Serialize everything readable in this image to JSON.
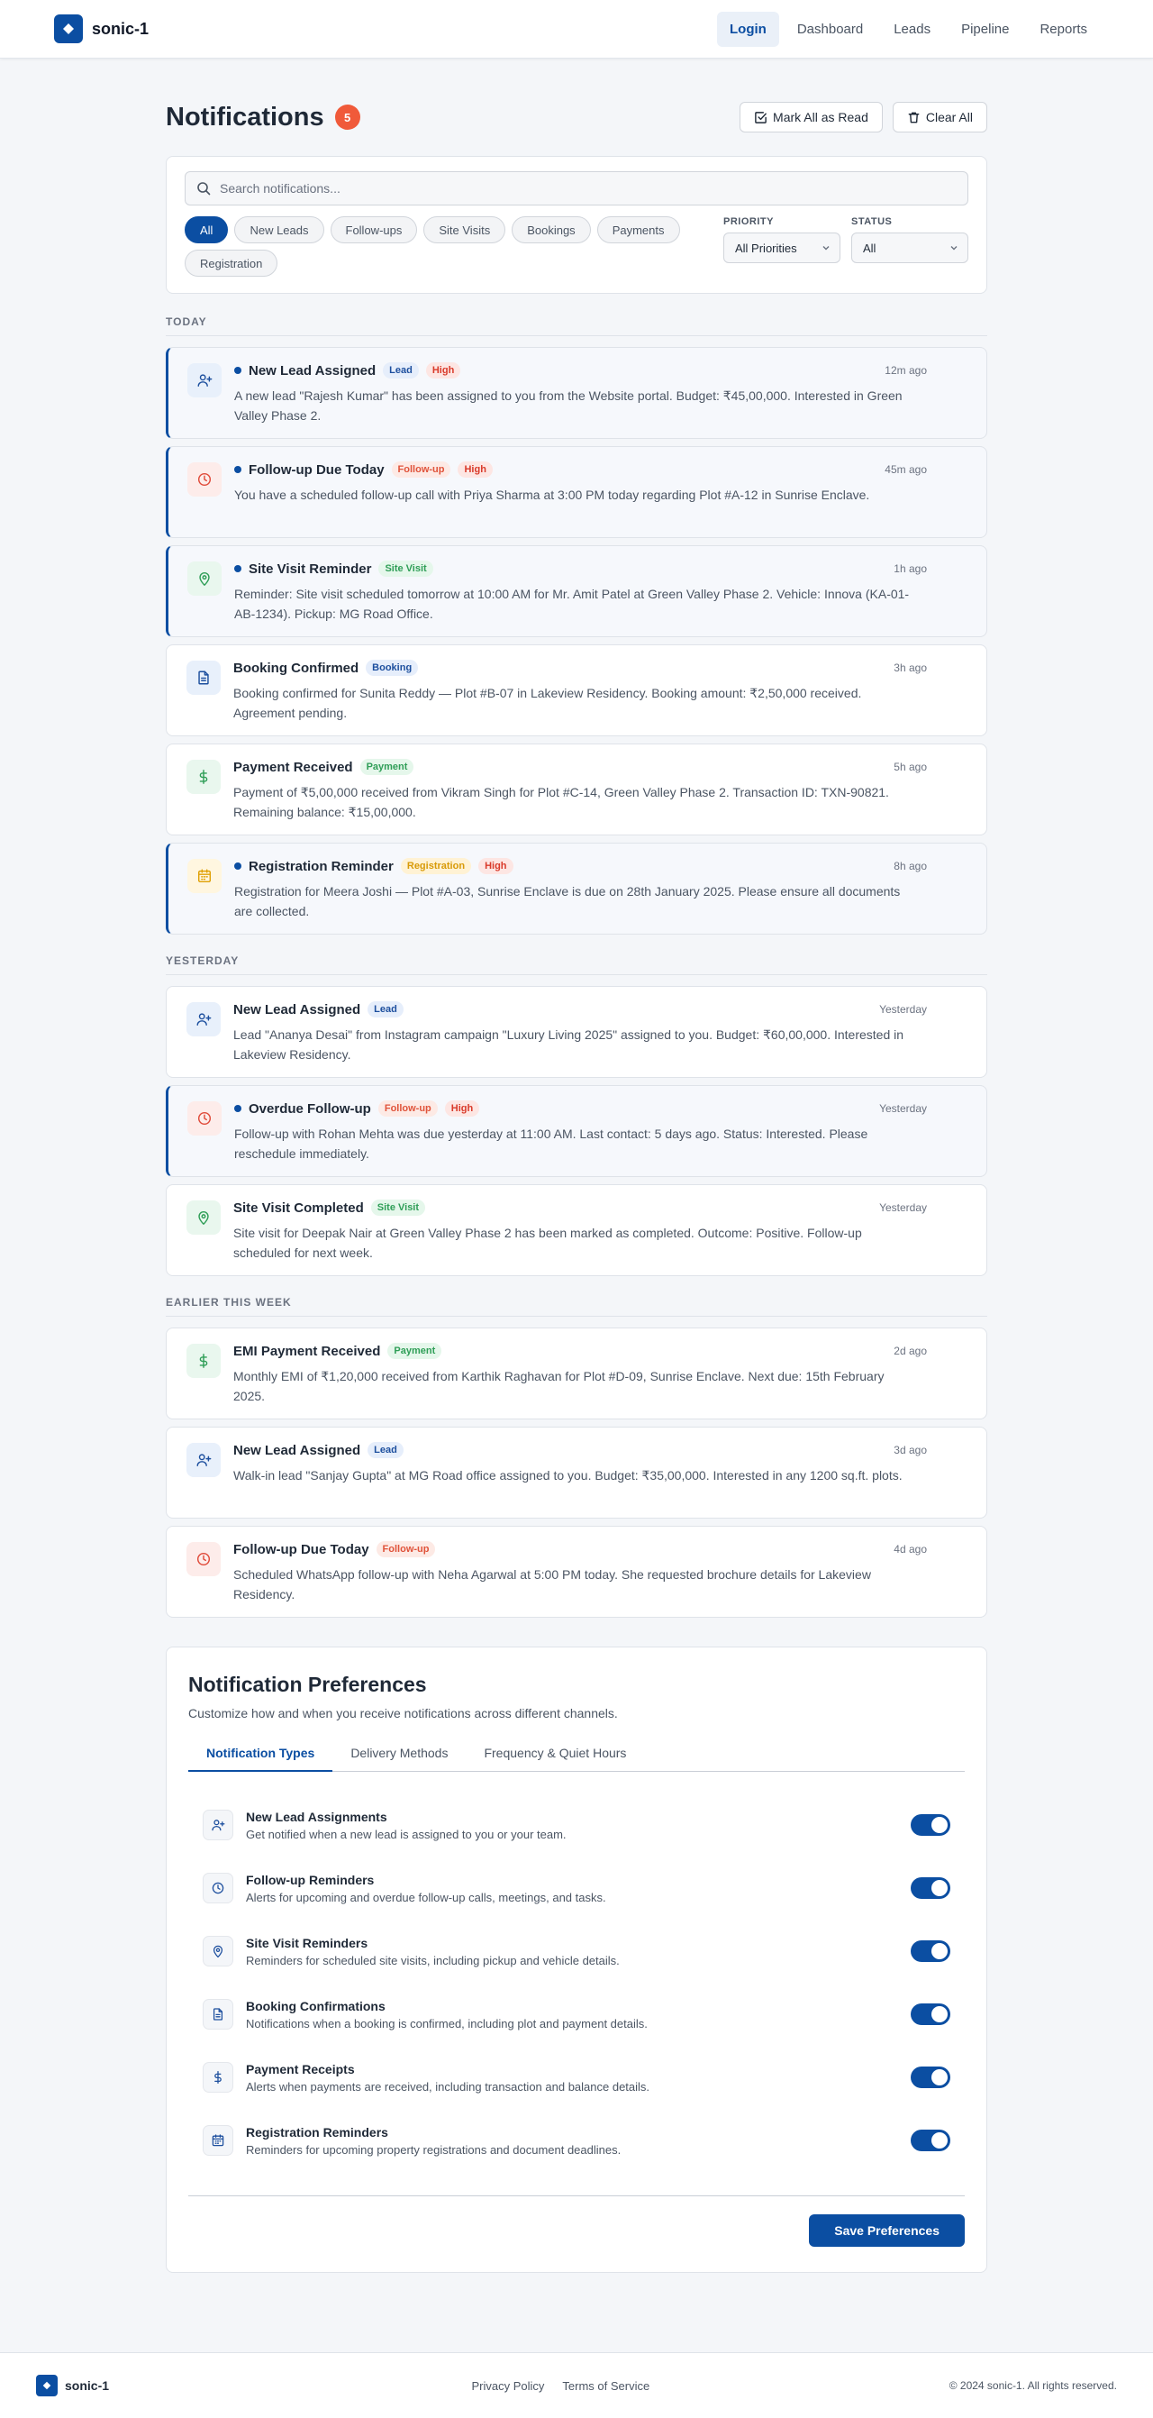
{
  "brand": {
    "name": "sonic-1",
    "logo_icon": "diamond-icon",
    "color": "#0b4ea2"
  },
  "nav": [
    {
      "label": "Login",
      "active": true
    },
    {
      "label": "Dashboard",
      "active": false
    },
    {
      "label": "Leads",
      "active": false
    },
    {
      "label": "Pipeline",
      "active": false
    },
    {
      "label": "Reports",
      "active": false
    }
  ],
  "header": {
    "title": "Notifications",
    "unread_count": "5",
    "mark_all_label": "Mark All as Read",
    "clear_all_label": "Clear All"
  },
  "filters": {
    "search_placeholder": "Search notifications...",
    "chips": [
      "All",
      "New Leads",
      "Follow-ups",
      "Site Visits",
      "Bookings",
      "Payments",
      "Registration"
    ],
    "active_chip": "All",
    "priority_label": "Priority",
    "priority_value": "All Priorities",
    "status_label": "Status",
    "status_value": "All"
  },
  "groups": [
    {
      "title": "Today",
      "items": [
        {
          "icon": "user-plus-icon",
          "kind": "lead",
          "unread": true,
          "title": "New Lead Assigned",
          "tag": "Lead",
          "priority": "High",
          "time": "12m ago",
          "message": "A new lead \"Rajesh Kumar\" has been assigned to you from the Website portal. Budget: ₹45,00,000. Interested in Green Valley Phase 2."
        },
        {
          "icon": "clock-icon",
          "kind": "follow",
          "unread": true,
          "title": "Follow-up Due Today",
          "tag": "Follow-up",
          "priority": "High",
          "time": "45m ago",
          "message": "You have a scheduled follow-up call with Priya Sharma at 3:00 PM today regarding Plot #A-12 in Sunrise Enclave."
        },
        {
          "icon": "map-pin-icon",
          "kind": "visit",
          "unread": true,
          "title": "Site Visit Reminder",
          "tag": "Site Visit",
          "priority": "",
          "time": "1h ago",
          "message": "Reminder: Site visit scheduled tomorrow at 10:00 AM for Mr. Amit Patel at Green Valley Phase 2. Vehicle: Innova (KA-01-AB-1234). Pickup: MG Road Office."
        },
        {
          "icon": "document-icon",
          "kind": "booking",
          "unread": false,
          "title": "Booking Confirmed",
          "tag": "Booking",
          "priority": "",
          "time": "3h ago",
          "message": "Booking confirmed for Sunita Reddy — Plot #B-07 in Lakeview Residency. Booking amount: ₹2,50,000 received. Agreement pending."
        },
        {
          "icon": "dollar-icon",
          "kind": "payment",
          "unread": false,
          "title": "Payment Received",
          "tag": "Payment",
          "priority": "",
          "time": "5h ago",
          "message": "Payment of ₹5,00,000 received from Vikram Singh for Plot #C-14, Green Valley Phase 2. Transaction ID: TXN-90821. Remaining balance: ₹15,00,000."
        },
        {
          "icon": "calendar-icon",
          "kind": "reg",
          "unread": true,
          "title": "Registration Reminder",
          "tag": "Registration",
          "priority": "High",
          "time": "8h ago",
          "message": "Registration for Meera Joshi — Plot #A-03, Sunrise Enclave is due on 28th January 2025. Please ensure all documents are collected."
        }
      ]
    },
    {
      "title": "Yesterday",
      "items": [
        {
          "icon": "user-plus-icon",
          "kind": "lead",
          "unread": false,
          "title": "New Lead Assigned",
          "tag": "Lead",
          "priority": "",
          "time": "Yesterday",
          "message": "Lead \"Ananya Desai\" from Instagram campaign \"Luxury Living 2025\" assigned to you. Budget: ₹60,00,000. Interested in Lakeview Residency."
        },
        {
          "icon": "clock-icon",
          "kind": "follow",
          "unread": true,
          "title": "Overdue Follow-up",
          "tag": "Follow-up",
          "priority": "High",
          "time": "Yesterday",
          "message": "Follow-up with Rohan Mehta was due yesterday at 11:00 AM. Last contact: 5 days ago. Status: Interested. Please reschedule immediately."
        },
        {
          "icon": "map-pin-icon",
          "kind": "visit",
          "unread": false,
          "title": "Site Visit Completed",
          "tag": "Site Visit",
          "priority": "",
          "time": "Yesterday",
          "message": "Site visit for Deepak Nair at Green Valley Phase 2 has been marked as completed. Outcome: Positive. Follow-up scheduled for next week."
        }
      ]
    },
    {
      "title": "Earlier This Week",
      "items": [
        {
          "icon": "dollar-icon",
          "kind": "payment",
          "unread": false,
          "title": "EMI Payment Received",
          "tag": "Payment",
          "priority": "",
          "time": "2d ago",
          "message": "Monthly EMI of ₹1,20,000 received from Karthik Raghavan for Plot #D-09, Sunrise Enclave. Next due: 15th February 2025."
        },
        {
          "icon": "user-plus-icon",
          "kind": "lead",
          "unread": false,
          "title": "New Lead Assigned",
          "tag": "Lead",
          "priority": "",
          "time": "3d ago",
          "message": "Walk-in lead \"Sanjay Gupta\" at MG Road office assigned to you. Budget: ₹35,00,000. Interested in any 1200 sq.ft. plots."
        },
        {
          "icon": "clock-icon",
          "kind": "follow",
          "unread": false,
          "title": "Follow-up Due Today",
          "tag": "Follow-up",
          "priority": "",
          "time": "4d ago",
          "message": "Scheduled WhatsApp follow-up with Neha Agarwal at 5:00 PM today. She requested brochure details for Lakeview Residency."
        }
      ]
    }
  ],
  "preferences": {
    "title": "Notification Preferences",
    "subtitle": "Customize how and when you receive notifications across different channels.",
    "tabs": [
      "Notification Types",
      "Delivery Methods",
      "Frequency & Quiet Hours"
    ],
    "active_tab": "Notification Types",
    "items": [
      {
        "icon": "user-plus-icon",
        "name": "New Lead Assignments",
        "desc": "Get notified when a new lead is assigned to you or your team.",
        "enabled": true
      },
      {
        "icon": "clock-icon",
        "name": "Follow-up Reminders",
        "desc": "Alerts for upcoming and overdue follow-up calls, meetings, and tasks.",
        "enabled": true
      },
      {
        "icon": "map-pin-icon",
        "name": "Site Visit Reminders",
        "desc": "Reminders for scheduled site visits, including pickup and vehicle details.",
        "enabled": true
      },
      {
        "icon": "document-icon",
        "name": "Booking Confirmations",
        "desc": "Notifications when a booking is confirmed, including plot and payment details.",
        "enabled": true
      },
      {
        "icon": "dollar-icon",
        "name": "Payment Receipts",
        "desc": "Alerts when payments are received, including transaction and balance details.",
        "enabled": true
      },
      {
        "icon": "calendar-icon",
        "name": "Registration Reminders",
        "desc": "Reminders for upcoming property registrations and document deadlines.",
        "enabled": true
      }
    ],
    "save_label": "Save Preferences"
  },
  "footer": {
    "brand": "sonic-1",
    "links": [
      "Privacy Policy",
      "Terms of Service"
    ],
    "copyright": "© 2024 sonic-1. All rights reserved."
  }
}
